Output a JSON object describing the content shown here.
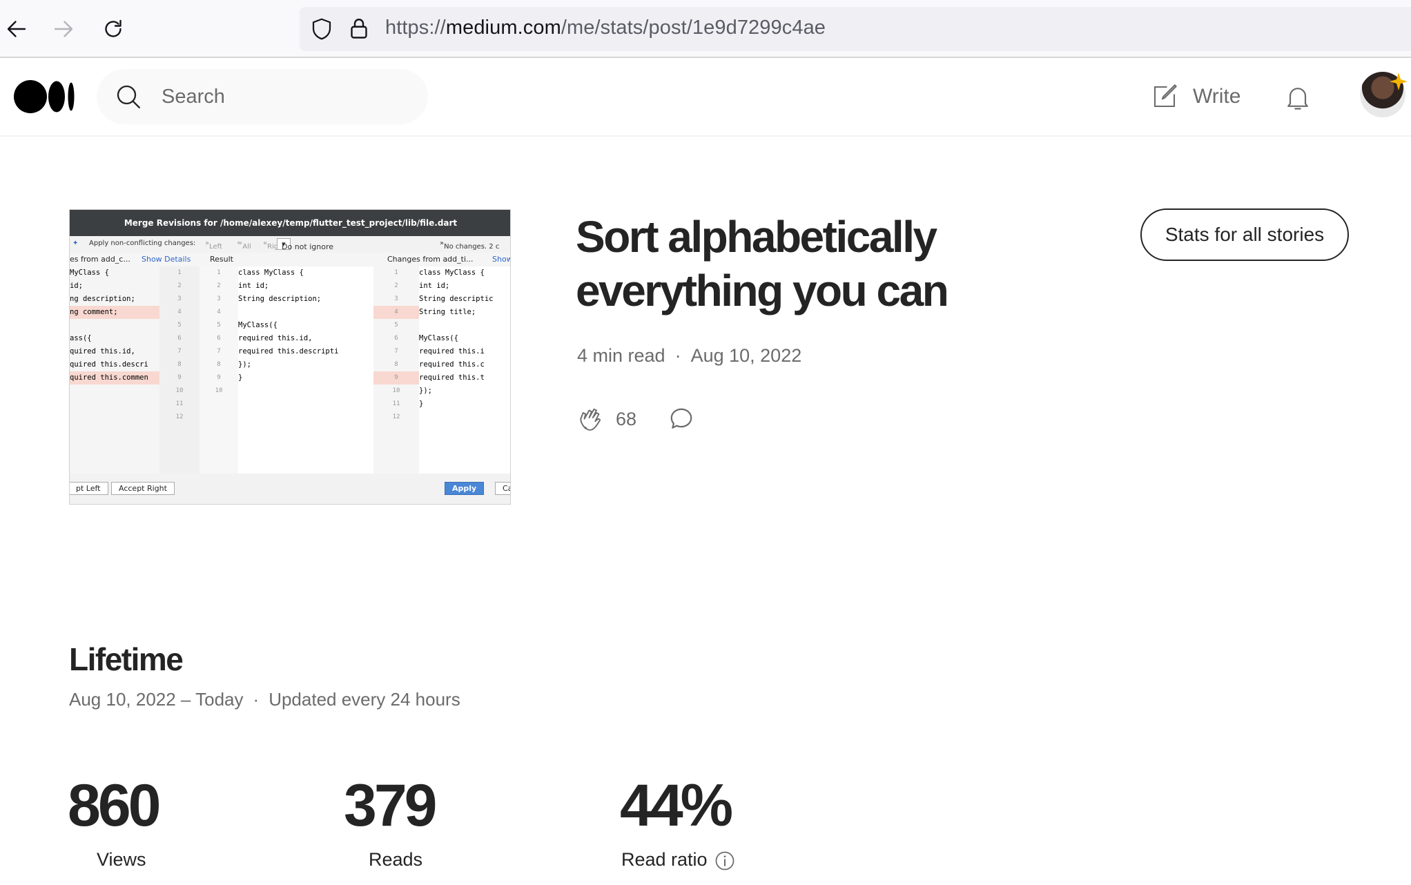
{
  "browser": {
    "url_scheme": "https://",
    "url_host": "medium.com",
    "url_path": "/me/stats/post/1e9d7299c4ae"
  },
  "header": {
    "search_placeholder": "Search",
    "write_label": "Write"
  },
  "thumbnail": {
    "window_title": "Merge Revisions for /home/alexey/temp/flutter_test_project/lib/file.dart",
    "toolbar": {
      "apply_nonconflicting": "Apply non-conflicting changes:",
      "left": "Left",
      "all": "All",
      "right": "Right",
      "ignore_select": "Do not ignore",
      "no_changes": "No changes. 2 c"
    },
    "subheader": {
      "left_changes": "es from add_c...",
      "show_details": "Show Details",
      "result": "Result",
      "right_changes": "Changes from add_ti...",
      "show": "Show"
    },
    "left_code": [
      "MyClass {",
      "id;",
      "ng description;",
      "ng comment;",
      "",
      "ass({",
      "quired this.id,",
      "quired this.descri",
      "quired this.commen"
    ],
    "result_code": [
      "class MyClass {",
      "  int id;",
      "  String description;",
      "",
      "  MyClass({",
      "    required this.id,",
      "    required this.descripti",
      "  });",
      "}"
    ],
    "right_code": [
      "class MyClass {",
      "  int id;",
      "  String descriptic",
      "  String title;",
      "",
      "  MyClass({",
      "    required this.i",
      "    required this.c",
      "    required this.t",
      "  });",
      "}"
    ],
    "buttons": {
      "accept_left": "pt Left",
      "accept_right": "Accept Right",
      "apply": "Apply",
      "cancel": "Ca"
    }
  },
  "story": {
    "title": "Sort alphabetically everything you can",
    "read_time": "4 min read",
    "date": "Aug 10, 2022",
    "claps": "68",
    "stats_all_button": "Stats for all stories"
  },
  "lifetime": {
    "title": "Lifetime",
    "range": "Aug 10, 2022 – Today",
    "update_note": "Updated every 24 hours",
    "stats": [
      {
        "value": "860",
        "label": "Views"
      },
      {
        "value": "379",
        "label": "Reads"
      },
      {
        "value": "44%",
        "label": "Read ratio"
      }
    ]
  },
  "colors": {
    "text_primary": "#242424",
    "text_secondary": "#6b6b6b",
    "search_bg": "#f9f9f9"
  }
}
